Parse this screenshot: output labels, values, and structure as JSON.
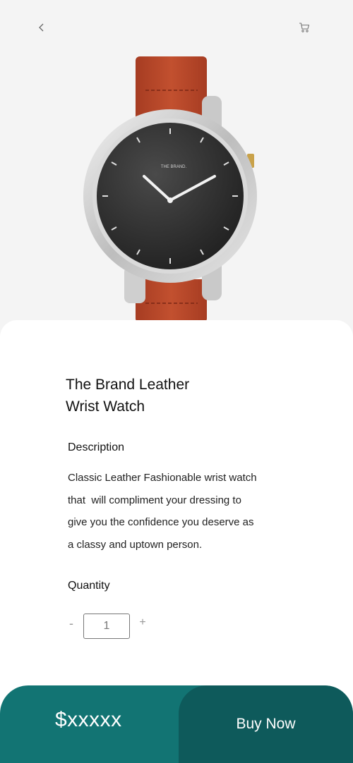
{
  "header": {
    "back_icon": "chevron-left-icon",
    "cart_icon": "cart-icon"
  },
  "product": {
    "image": "wrist-watch-image",
    "title_line1": "The Brand Leather",
    "title_line2": "Wrist Watch",
    "dial_brand": "THE BRAND."
  },
  "description": {
    "heading": "Description",
    "line1": "Classic Leather Fashionable wrist watch",
    "line2": "that  will compliment your dressing to",
    "line3": "give you the confidence you deserve as",
    "line4": "a classy and uptown person."
  },
  "quantity": {
    "heading": "Quantity",
    "minus_label": "-",
    "value": "1",
    "plus_label": "+"
  },
  "checkout": {
    "price": "$xxxxx",
    "buy_label": "Buy Now"
  },
  "colors": {
    "accent": "#127473",
    "accent_dark": "#0e5a5b",
    "strap": "#b5452a",
    "background": "#f4f4f4"
  }
}
